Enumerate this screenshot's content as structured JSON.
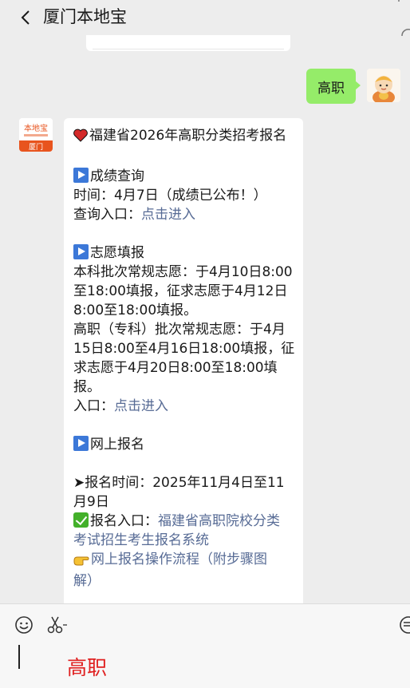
{
  "header": {
    "title": "厦门本地宝",
    "back_icon": "chevron-left-icon"
  },
  "chat": {
    "me": {
      "text": "高职",
      "bubble_color": "#95ec69"
    },
    "bot": {
      "avatar_text_top": "本地宝",
      "avatar_text_bottom": "厦门",
      "lines": {
        "l1": "福建省2026年高职分类招考报名",
        "l2": "成绩查询",
        "l3": "时间：4月7日（成绩已公布！）",
        "l4_prefix": "查询入口：",
        "l4_link": "点击进入",
        "l5": "志愿填报",
        "l6": "本科批次常规志愿：于4月10日8:00",
        "l7": "至18:00填报，征求志愿于4月12日",
        "l8": "8:00至18:00填报。",
        "l9": "高职（专科）批次常规志愿：于4月",
        "l10": "15日8:00至4月16日18:00填报，征",
        "l11": "求志愿于4月20日8:00至18:00填",
        "l12": "报。",
        "l13_prefix": "入口：",
        "l13_link": "点击进入",
        "l14": "网上报名",
        "l15": "➤报名时间：2025年11月4日至11",
        "l16": "月9日",
        "l17_prefix": "报名入口：",
        "l17_link": "福建省高职院校分类",
        "l18_link": "考试招生考生报名系统",
        "l19_link": "网上报名操作流程（附步骤图",
        "l20_link": "解）"
      },
      "link_color": "#576b95"
    }
  },
  "footer": {
    "input_value": "高职",
    "input_color": "#e02020",
    "emoji_icon": "smiley-icon",
    "scissors_icon": "scissors-icon",
    "menu_icon": "chat-menu-icon"
  }
}
